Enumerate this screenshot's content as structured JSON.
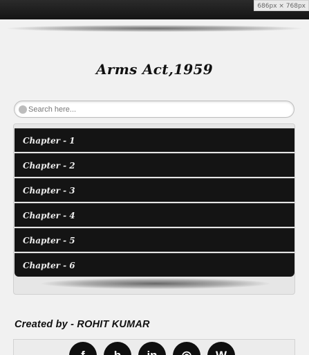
{
  "browser": {
    "dimension_badge": "686px × 768px"
  },
  "page": {
    "title": "Arms Act,1959"
  },
  "search": {
    "placeholder": "Search here..."
  },
  "chapters": [
    {
      "label": "Chapter - 1"
    },
    {
      "label": "Chapter - 2"
    },
    {
      "label": "Chapter - 3"
    },
    {
      "label": "Chapter - 4"
    },
    {
      "label": "Chapter - 5"
    },
    {
      "label": "Chapter - 6"
    }
  ],
  "footer": {
    "credit": "Created by - ROHIT KUMAR",
    "social": [
      {
        "icon": "facebook-icon",
        "glyph": "f"
      },
      {
        "icon": "blogger-icon",
        "glyph": "b"
      },
      {
        "icon": "linkedin-icon",
        "glyph": "in"
      },
      {
        "icon": "dribbble-icon",
        "glyph": "◎"
      },
      {
        "icon": "wordpress-icon",
        "glyph": "W"
      }
    ]
  }
}
